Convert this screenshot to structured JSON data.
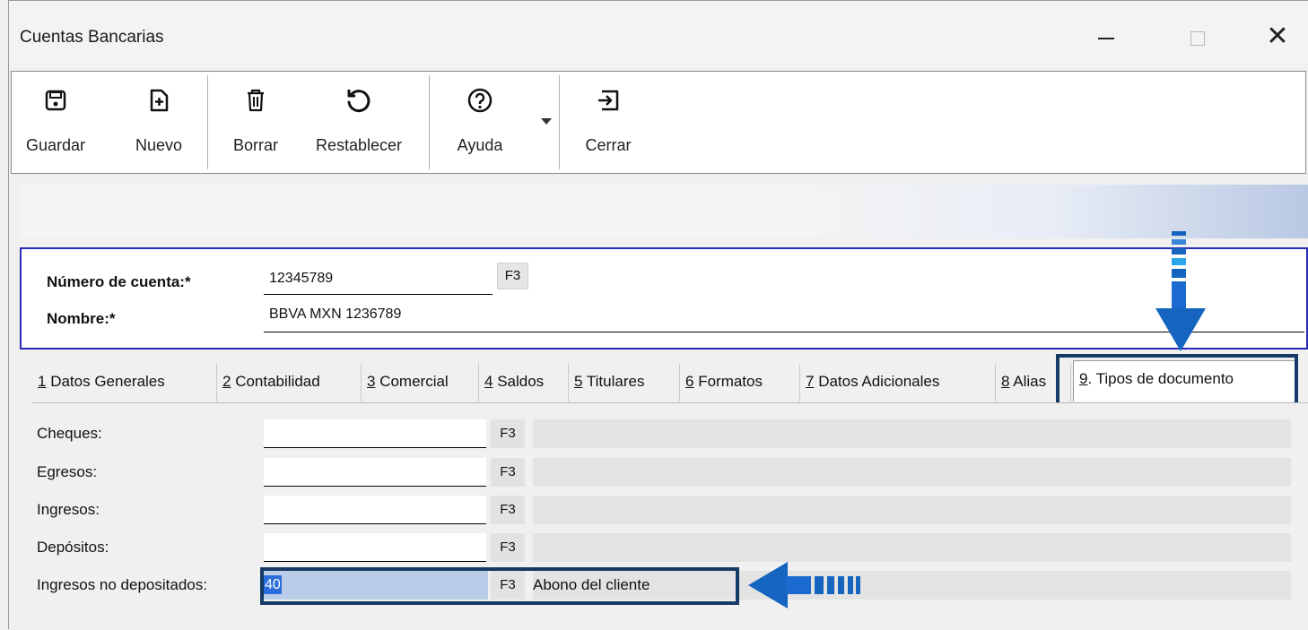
{
  "window": {
    "title": "Cuentas Bancarias",
    "controls": {
      "minimize": "—",
      "maximize": "☐",
      "close": "✕"
    }
  },
  "toolbar": {
    "save_label": "Guardar",
    "new_label": "Nuevo",
    "delete_label": "Borrar",
    "reset_label": "Restablecer",
    "help_label": "Ayuda",
    "close_label": "Cerrar",
    "icons": [
      "save-icon",
      "new-document-icon",
      "trash-icon",
      "undo-icon",
      "help-icon",
      "exit-icon"
    ]
  },
  "header": {
    "account_number_label": "Número de cuenta:*",
    "account_number_value": "12345789",
    "account_number_key": "F3",
    "name_label": "Nombre:*",
    "name_value": "BBVA MXN 1236789"
  },
  "tabs": [
    {
      "num": "1",
      "label": " Datos Generales"
    },
    {
      "num": "2",
      "label": " Contabilidad"
    },
    {
      "num": "3",
      "label": " Comercial"
    },
    {
      "num": "4",
      "label": " Saldos"
    },
    {
      "num": "5",
      "label": " Titulares"
    },
    {
      "num": "6",
      "label": " Formatos"
    },
    {
      "num": "7",
      "label": " Datos Adicionales"
    },
    {
      "num": "8",
      "label": " Alias"
    },
    {
      "num": "9",
      "label": ". Tipos de documento"
    }
  ],
  "fields": [
    {
      "label": "Cheques:",
      "value": "",
      "key": "F3",
      "desc": ""
    },
    {
      "label": "Egresos:",
      "value": "",
      "key": "F3",
      "desc": ""
    },
    {
      "label": "Ingresos:",
      "value": "",
      "key": "F3",
      "desc": ""
    },
    {
      "label": "Depósitos:",
      "value": "",
      "key": "F3",
      "desc": ""
    },
    {
      "label": "Ingresos no depositados:",
      "value": "40",
      "key": "F3",
      "desc": "Abono del cliente"
    }
  ],
  "colors": {
    "accent": "#163a66",
    "arrow": "#1565c0",
    "header_border": "#2a2ab8"
  }
}
